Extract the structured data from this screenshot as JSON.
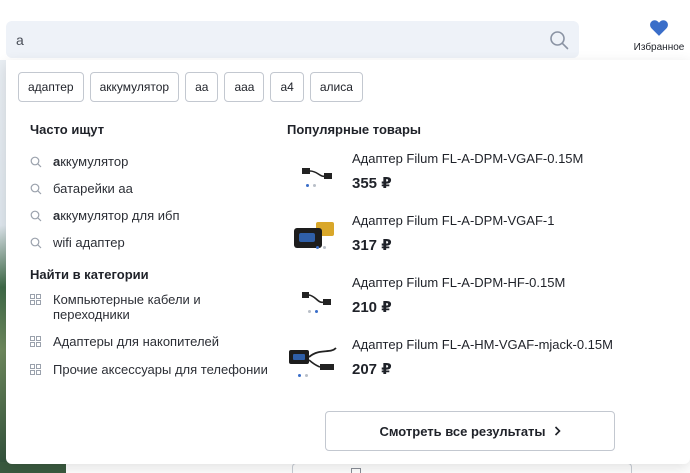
{
  "search": {
    "value": "а",
    "placeholder": ""
  },
  "favorites": {
    "label": "Избранное"
  },
  "chips": [
    "адаптер",
    "аккумулятор",
    "аа",
    "ааа",
    "а4",
    "алиса"
  ],
  "frequent": {
    "title": "Часто ищут",
    "items": [
      {
        "bold": "а",
        "rest": "ккумулятор"
      },
      {
        "bold": "",
        "rest": "батарейки аа"
      },
      {
        "bold": "а",
        "rest": "ккумулятор для ибп"
      },
      {
        "bold": "",
        "rest": "wifi адаптер"
      }
    ]
  },
  "categories": {
    "title": "Найти в категории",
    "items": [
      "Компьютерные кабели и переходники",
      "Адаптеры для накопителей",
      "Прочие аксессуары для телефонии"
    ]
  },
  "popular": {
    "title": "Популярные товары",
    "items": [
      {
        "name": "Адаптер Filum FL-A-DPM-VGAF-0.15M",
        "price": "355 ₽"
      },
      {
        "name": "Адаптер Filum FL-A-DPM-VGAF-1",
        "price": "317 ₽"
      },
      {
        "name": "Адаптер Filum FL-A-DPM-HF-0.15M",
        "price": "210 ₽"
      },
      {
        "name": "Адаптер Filum FL-A-HM-VGAF-mjack-0.15M",
        "price": "207 ₽"
      }
    ]
  },
  "all_results": {
    "label": "Смотреть все результаты"
  },
  "colors": {
    "accent": "#3a6ec9",
    "search_bg": "#eef2f8"
  }
}
